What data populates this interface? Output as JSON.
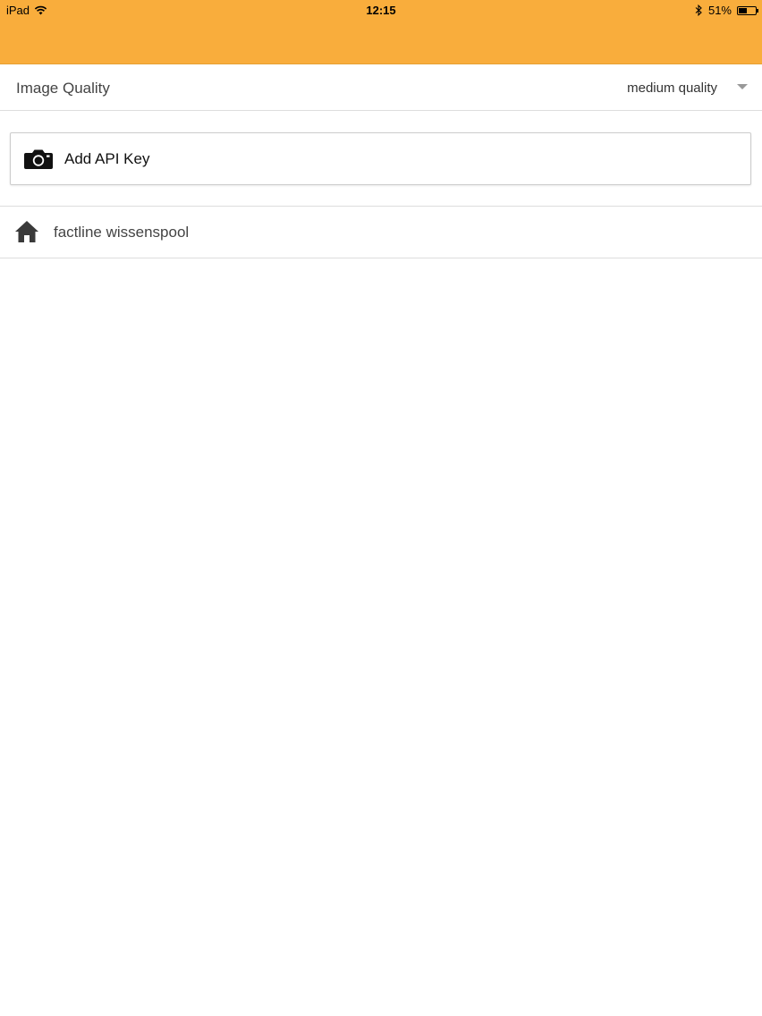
{
  "status_bar": {
    "device": "iPad",
    "time": "12:15",
    "battery_percent": "51%",
    "battery_level": 0.51,
    "icons": [
      "wifi-icon",
      "bluetooth-icon",
      "battery-icon"
    ]
  },
  "header": {
    "background_color": "#f9ad3c"
  },
  "settings": {
    "image_quality_label": "Image Quality",
    "image_quality_value": "medium quality"
  },
  "api_button": {
    "icon": "camera-icon",
    "label": "Add API Key"
  },
  "list": {
    "items": [
      {
        "icon": "home-icon",
        "label": "factline wissenspool"
      }
    ]
  }
}
